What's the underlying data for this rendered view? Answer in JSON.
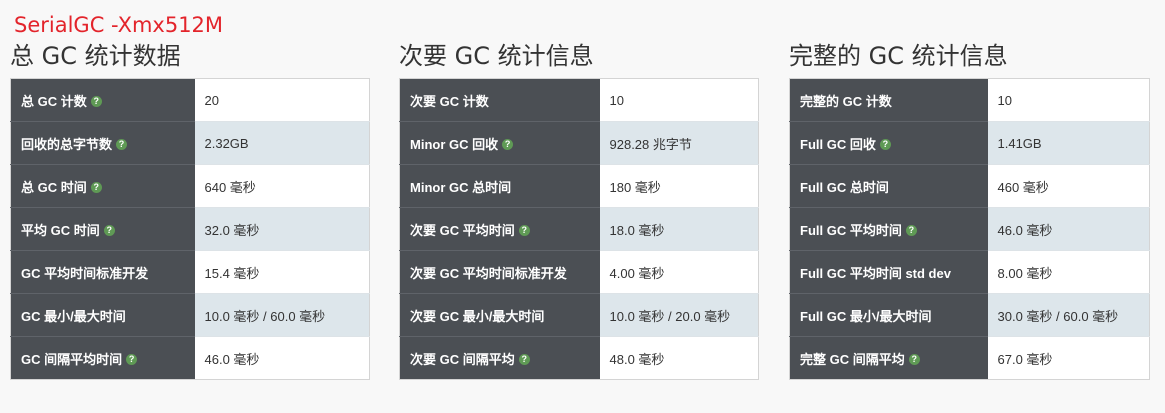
{
  "label": "SerialGC -Xmx512M",
  "icons": {
    "help": "question-circle-icon"
  },
  "colors": {
    "label": "#e3242b",
    "key_bg": "#4b4f54",
    "alt_row": "#dde6eb",
    "help": "#5f9a55"
  },
  "panels": [
    {
      "title": "总 GC 统计数据",
      "rows": [
        {
          "key": "总 GC 计数",
          "help": true,
          "value": "20"
        },
        {
          "key": "回收的总字节数",
          "help": true,
          "value": "2.32GB"
        },
        {
          "key": "总 GC 时间",
          "help": true,
          "value": "640 毫秒"
        },
        {
          "key": "平均 GC 时间",
          "help": true,
          "value": "32.0 毫秒"
        },
        {
          "key": "GC 平均时间标准开发",
          "help": false,
          "value": "15.4 毫秒"
        },
        {
          "key": "GC 最小/最大时间",
          "help": false,
          "value": "10.0 毫秒 / 60.0 毫秒"
        },
        {
          "key": "GC 间隔平均时间",
          "help": true,
          "value": "46.0 毫秒"
        }
      ]
    },
    {
      "title": "次要 GC 统计信息",
      "rows": [
        {
          "key": "次要 GC 计数",
          "help": false,
          "value": "10"
        },
        {
          "key": "Minor GC 回收",
          "help": true,
          "value": "928.28 兆字节"
        },
        {
          "key": "Minor GC 总时间",
          "help": false,
          "value": "180 毫秒"
        },
        {
          "key": "次要 GC 平均时间",
          "help": true,
          "value": "18.0 毫秒"
        },
        {
          "key": "次要 GC 平均时间标准开发",
          "help": false,
          "value": "4.00 毫秒"
        },
        {
          "key": "次要 GC 最小/最大时间",
          "help": false,
          "value": "10.0 毫秒 / 20.0 毫秒"
        },
        {
          "key": "次要 GC 间隔平均",
          "help": true,
          "value": "48.0 毫秒"
        }
      ]
    },
    {
      "title": "完整的 GC 统计信息",
      "rows": [
        {
          "key": "完整的 GC 计数",
          "help": false,
          "value": "10"
        },
        {
          "key": "Full GC 回收",
          "help": true,
          "value": "1.41GB"
        },
        {
          "key": "Full GC 总时间",
          "help": false,
          "value": "460 毫秒"
        },
        {
          "key": "Full GC 平均时间",
          "help": true,
          "value": "46.0 毫秒"
        },
        {
          "key": "Full GC 平均时间 std dev",
          "help": false,
          "value": "8.00 毫秒"
        },
        {
          "key": "Full GC 最小/最大时间",
          "help": false,
          "value": "30.0 毫秒 / 60.0 毫秒"
        },
        {
          "key": "完整 GC 间隔平均",
          "help": true,
          "value": "67.0 毫秒"
        }
      ]
    }
  ]
}
